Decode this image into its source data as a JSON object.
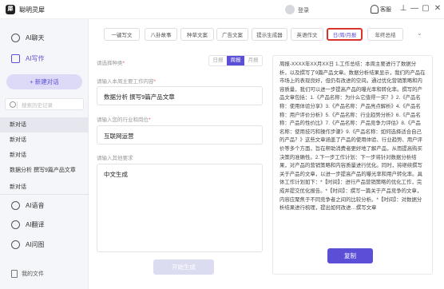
{
  "app": {
    "title": "聪明灵犀",
    "logo_char": "犀",
    "login_label": "登录",
    "service_label": "客服"
  },
  "window": {
    "pin": "⊥",
    "minimize": "—",
    "maximize": "▢",
    "close": "✕"
  },
  "sidebar": {
    "nav": [
      {
        "label": "AI聊天",
        "icon": "chat-icon"
      },
      {
        "label": "AI写作",
        "icon": "write-icon"
      }
    ],
    "new_chat_label": "+ 新建对话",
    "search_placeholder": "搜索历史记录",
    "history": [
      "新对话",
      "新对话",
      "新对话",
      "数据分析 撰写9篇产品文章",
      "新对话"
    ],
    "tools": [
      {
        "label": "AI语音",
        "icon": "voice-icon"
      },
      {
        "label": "AI翻译",
        "icon": "translate-icon"
      },
      {
        "label": "AI问图",
        "icon": "image-question-icon"
      }
    ],
    "my_files_label": "我的文件"
  },
  "tabs": [
    {
      "label": "一键写文"
    },
    {
      "label": "八卦故事"
    },
    {
      "label": "种草文案"
    },
    {
      "label": "广告文案"
    },
    {
      "label": "提示生成器"
    },
    {
      "label": "英语作文"
    },
    {
      "label": "日/周/月报",
      "active": true
    },
    {
      "label": "年终总结"
    }
  ],
  "form": {
    "type_label": "请选择种类",
    "type_options": [
      "日报",
      "周报",
      "月报"
    ],
    "type_selected": "周报",
    "work_label": "请输入本周主要工作内容",
    "work_value": "数据分析 撰写9篇产品文章",
    "industry_label": "请输入您的行业和岗位",
    "industry_value": "互联网运营",
    "other_label": "请输入其他要求",
    "other_value": "中文生成",
    "generate_label": "开始生成"
  },
  "output": {
    "text": "周报-XXXX年XX月XX日 1.工作总结：本周主要进行了数据分析，以及撰写了9篇产品文章。数据分析结果显示，我们的产品在市场上的表现良好，但仍有改进的空间。通过优化营销策略和内容质量，我们可以进一步提高产品的曝光率和转化率。撰写的产品文章包括：1.《产品名称：为什么它值得一买？》2.《产品名称：使用体验分享》3.《产品名称：产品亮点解析》4.《产品名称：用户评价分析》5.《产品名称：行业趋势分析》6.《产品名称：产品的性价比》7.《产品名称：产品竞争力评估》8.《产品名称：使用技巧和操作步骤》9.《产品名称：如何选择适合自己的产品？》这些文章涵盖了产品的使用体验、行业趋势、用户评价等多个方面，旨在帮助消费者更好地了解产品，从而提高购买决策的准确性。2.下一步工作计划：下一步将针对数据分析结果，对产品的营销策略和内容质量进行优化。同时，将继续撰写关于产品的文章，以进一步提高产品的曝光率和用户转化率。具体工作计划如下：*【时间】：进行产品营销策略的优化工作，完成并提交优化报告。*【时间】：撰写一篇关于产品竞争的文章，内容应聚焦于不同竞争者之间的比较分析。*【时间】：对数据分析结果进行梳理，提出如何改进…撰写文章",
    "copy_label": "复制"
  },
  "accent_color": "#5b4fd8",
  "highlight_color": "#d9342b"
}
